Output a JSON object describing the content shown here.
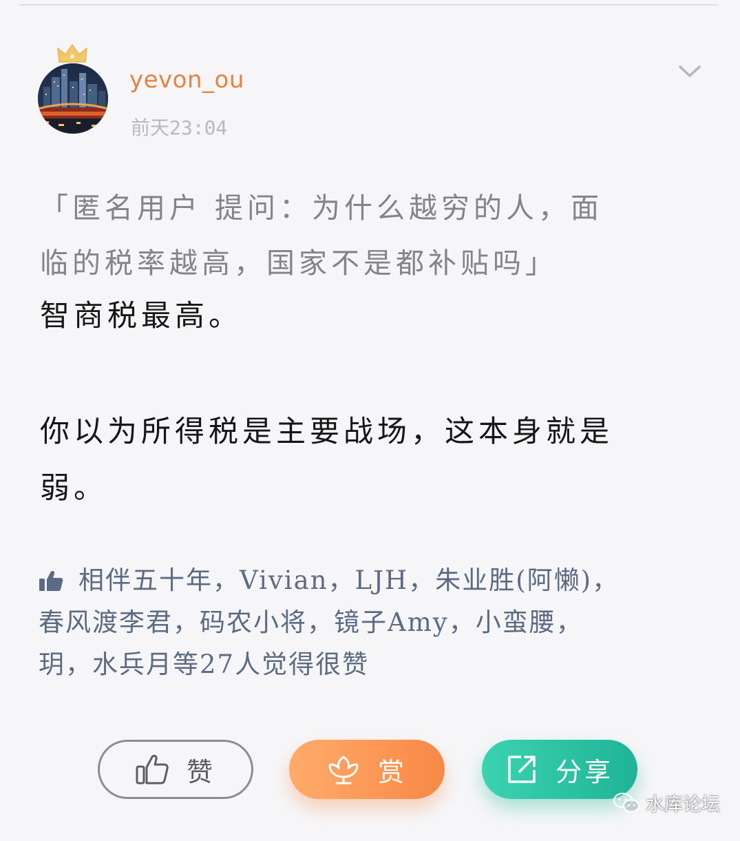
{
  "post": {
    "username": "yevon_ou",
    "timestamp": "前天23:04",
    "quote_line1": "「匿名用户 提问：为什么越穷的人，面",
    "quote_line2": "临的税率越高，国家不是都补贴吗」",
    "paragraph1": "智商税最高。",
    "paragraph2_line1": "你以为所得税是主要战场，这本身就是",
    "paragraph2_line2": "弱。"
  },
  "likes": {
    "line1": "相伴五十年，Vivian，LJH，朱业胜(阿懒)，",
    "line2": "春风渡李君，码农小将，镜子Amy，小蛮腰，",
    "line3": "玥，水兵月等27人觉得很赞"
  },
  "actions": {
    "like_label": "赞",
    "reward_label": "赏",
    "share_label": "分享"
  },
  "watermark": {
    "text": "水库论坛"
  },
  "icons": {
    "crown": "crown-icon",
    "more": "chevron-down-icon",
    "likes": "thumbs-up-icon",
    "like_button": "thumbs-up-outline-icon",
    "reward_button": "flower-icon",
    "share_button": "share-icon",
    "watermark": "wechat-icon"
  },
  "colors": {
    "username": "#e8823c",
    "likes_text": "#5a6b83",
    "reward_button": "#f88846",
    "share_button": "#1fb496"
  }
}
